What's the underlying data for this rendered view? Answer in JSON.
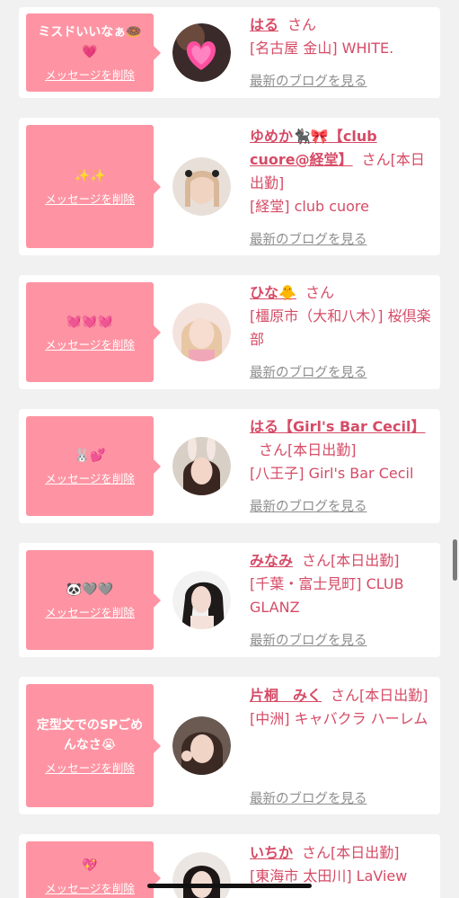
{
  "delete_label": "メッセージを削除",
  "blog_label": "最新のブログを見る",
  "cards": [
    {
      "message": "ミスドいいなぁ🍩💗",
      "name": "はる",
      "san": "さん",
      "shop": "[名古屋 金山] WHITE."
    },
    {
      "message": "✨✨",
      "name": "ゆめか🐈‍⬛🎀【club cuore@経堂】",
      "san": "さん[本日出勤]",
      "shop": "[経堂] club cuore"
    },
    {
      "message": "💓💓💓",
      "name": "ひな🐥",
      "san": "さん",
      "shop": "[橿原市（大和八木）] 桜倶楽部"
    },
    {
      "message": "🐰💕",
      "name": "はる【Girl's Bar Cecil】",
      "san": "さん[本日出勤]",
      "shop": "[八王子] Girl's Bar Cecil"
    },
    {
      "message": "🐼🩶🩶",
      "name": "みなみ",
      "san": "さん[本日出勤]",
      "shop": "[千葉・富士見町] CLUB GLANZ"
    },
    {
      "message": "定型文でのSPごめんなさ😭",
      "name": "片桐　みく",
      "san": "さん[本日出勤]",
      "shop": "[中洲] キャバクラ ハーレム"
    },
    {
      "message": "💖",
      "name": "いちか",
      "san": "さん[本日出勤]",
      "shop": "[東海市 太田川] LaView"
    }
  ]
}
